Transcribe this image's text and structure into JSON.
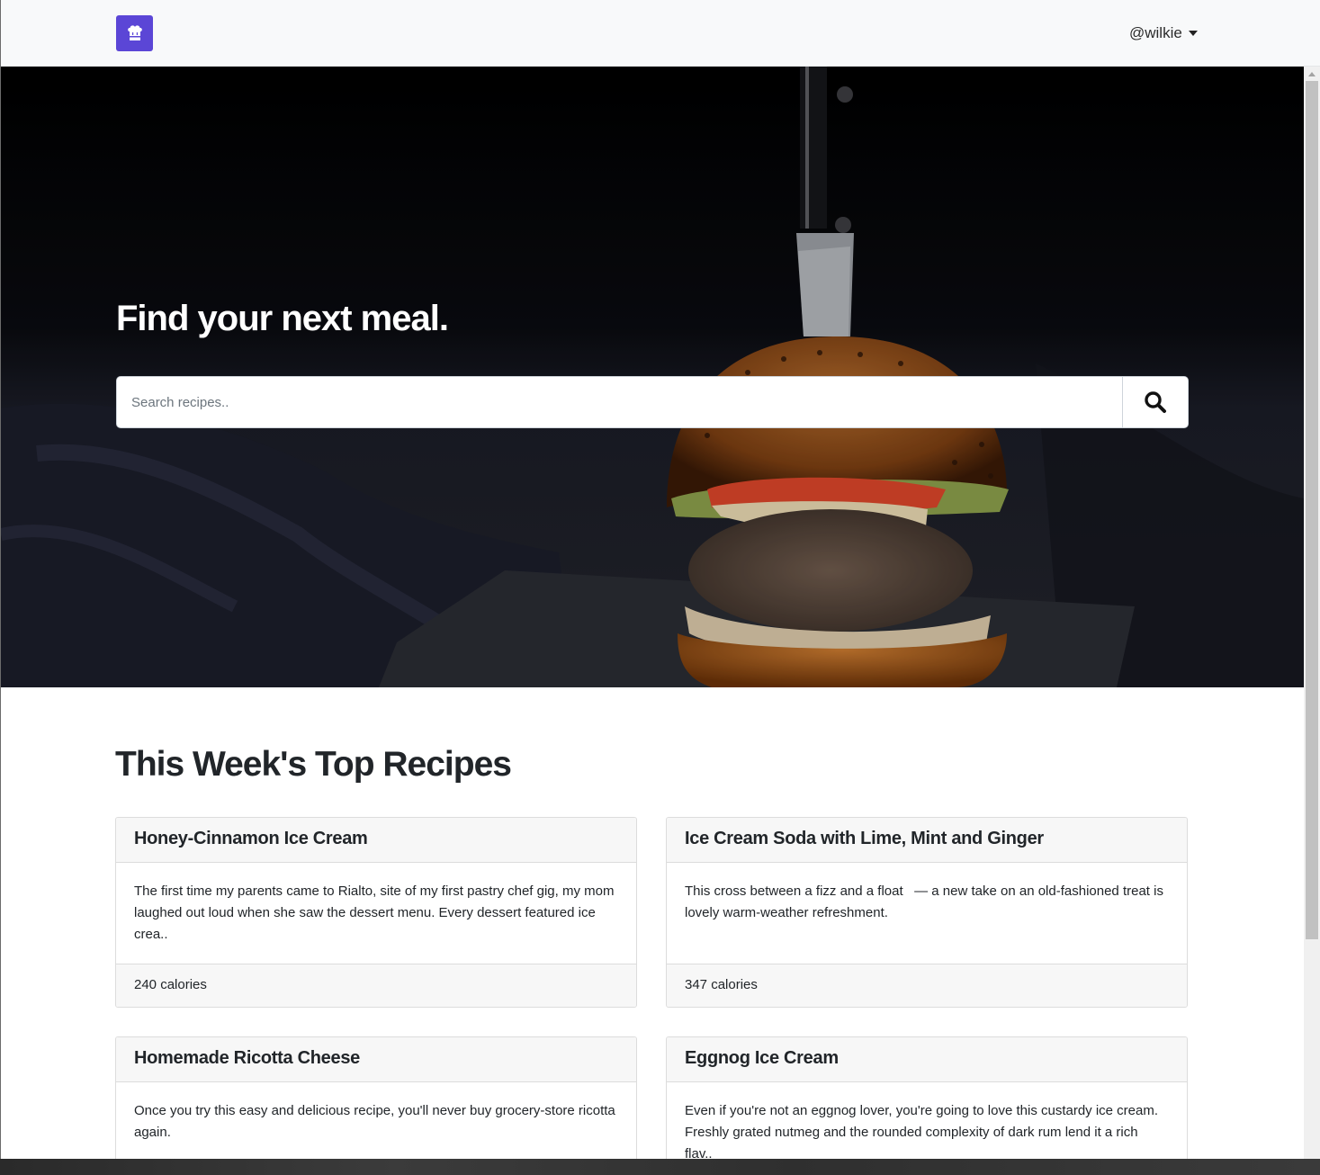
{
  "navbar": {
    "brand_icon": "chef-hat-icon",
    "brand_color": "#5b46d6",
    "username": "@wilkie"
  },
  "hero": {
    "title": "Find your next meal.",
    "search": {
      "placeholder": "Search recipes..",
      "value": "",
      "button_icon": "search-icon"
    }
  },
  "section": {
    "title": "This Week's Top Recipes"
  },
  "recipes": [
    {
      "title": "Honey-Cinnamon Ice Cream",
      "description": "The first time my parents came to Rialto, site of my first pastry chef gig, my mom laughed out loud when she saw the dessert menu. Every dessert featured ice crea..",
      "calories": "240 calories"
    },
    {
      "title": "Ice Cream Soda with Lime, Mint and Ginger",
      "description": "This cross between a fizz and a float   — a new take on an old-fashioned treat is lovely warm-weather refreshment.",
      "calories": "347 calories"
    },
    {
      "title": "Homemade Ricotta Cheese",
      "description": "Once you try this easy and delicious recipe, you'll never buy grocery-store ricotta again.",
      "calories": ""
    },
    {
      "title": "Eggnog Ice Cream",
      "description": "Even if you're not an eggnog lover, you're going to love this custardy ice cream. Freshly grated nutmeg and the rounded complexity of dark rum lend it a rich flav..",
      "calories": ""
    }
  ]
}
